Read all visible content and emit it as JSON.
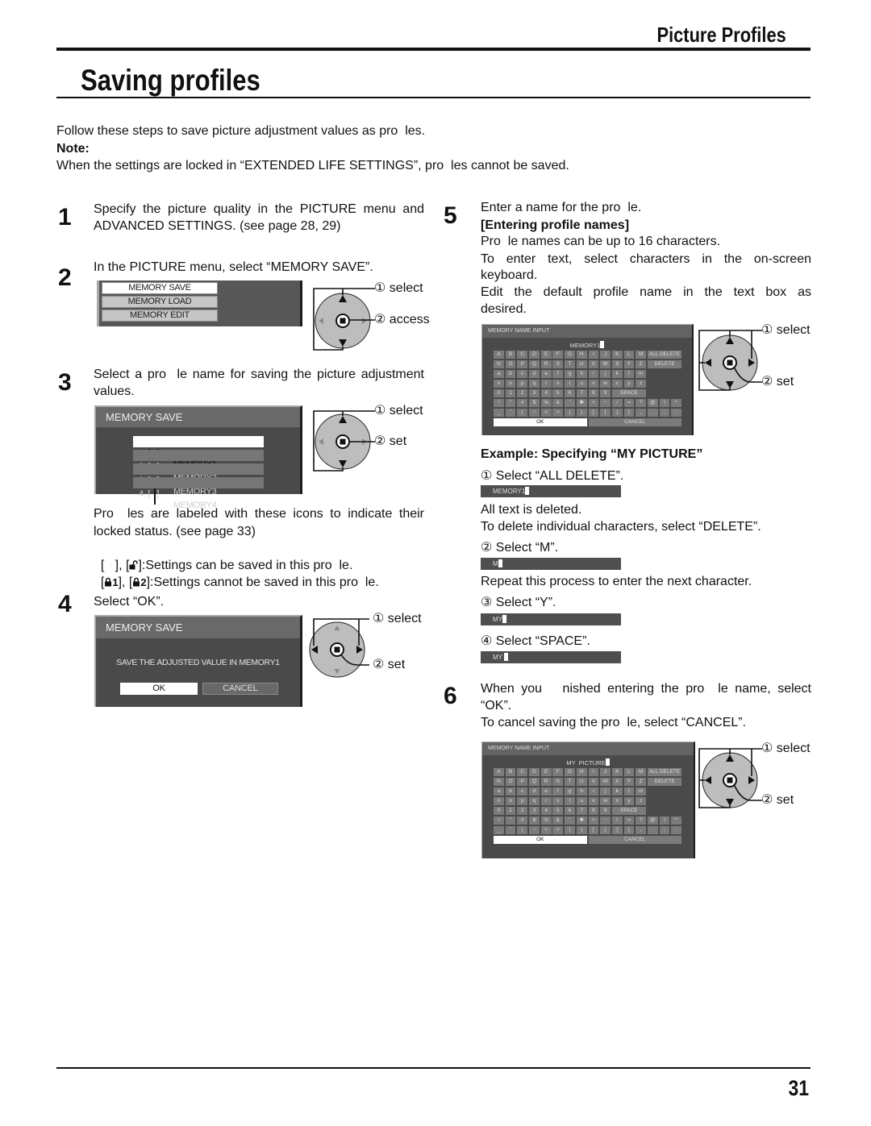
{
  "header": {
    "section_title": "Picture Profiles",
    "page_title": "Saving profiles"
  },
  "intro": {
    "text": "Follow these steps to save picture adjustment values as pro  les.",
    "note_label": "Note:",
    "note_text": "When the settings are locked in “EXTENDED LIFE SETTINGS”, pro  les cannot be saved."
  },
  "step1": {
    "number": "1",
    "lines": [
      "Specify the picture quality in the PICTURE menu and",
      "ADVANCED SETTINGS. (see page 28, 29)"
    ]
  },
  "step2": {
    "number": "2",
    "text": "In the PICTURE menu, select “MEMORY SAVE”.",
    "menu": {
      "items": [
        "MEMORY SAVE",
        "MEMORY LOAD",
        "MEMORY EDIT"
      ],
      "selected": "MEMORY SAVE"
    },
    "remote": {
      "select_label": "① select",
      "action_label": "② access"
    }
  },
  "step3": {
    "number": "3",
    "lines": [
      "Select a pro  le name for saving the picture adjustment",
      "values."
    ],
    "screen": {
      "title": "MEMORY SAVE",
      "items": [
        {
          "index": "1. [   ]",
          "name": "MEMORY1"
        },
        {
          "index": "2. [   ]",
          "name": "MEMORY2"
        },
        {
          "index": "3. [   ]",
          "name": "MEMORY3"
        },
        {
          "index": "4. [   ]",
          "name": "MEMORY4"
        }
      ],
      "selected": "MEMORY1"
    },
    "remote": {
      "select_label": "① select",
      "action_label": "② set"
    },
    "legend": {
      "lines": [
        "Pro  les are labeled with these icons to indicate their",
        "locked status. (see page 33)"
      ],
      "unlocked": {
        "prefix": "[   ], [",
        "suffix": "]:Settings can be saved in this pro  le."
      },
      "locked": {
        "open": "[",
        "num1": "1",
        "sep": "], [",
        "num2": "2",
        "suffix": "]:Settings cannot be saved in this pro  le."
      }
    }
  },
  "step4": {
    "number": "4",
    "text": "Select “OK”.",
    "screen": {
      "title": "MEMORY SAVE",
      "message": "SAVE THE ADJUSTED VALUE IN MEMORY1",
      "ok_label": "OK",
      "cancel_label": "CANCEL",
      "selected": "OK"
    },
    "remote": {
      "select_label": "① select",
      "action_label": "② set"
    }
  },
  "step5": {
    "number": "5",
    "text": "Enter a name for the pro  le.",
    "subheading": "[Entering profile names]",
    "body_lines": [
      "Pro  le names can be up to 16 characters.",
      "To enter text, select characters in the on-screen",
      "keyboard.",
      "Edit the default profile name in the text box as",
      "desired."
    ],
    "keyboard": {
      "title": "MEMORY NAME INPUT",
      "name_value": "MEMORY1",
      "selected_key": "OK"
    },
    "remote": {
      "select_label": "① select",
      "action_label": "② set"
    },
    "example": {
      "heading": "Example: Specifying “MY PICTURE”",
      "substeps": [
        {
          "label": "① Select “ALL DELETE”.",
          "field": "MEMORY1",
          "notes": [
            "All text is deleted.",
            "To delete individual characters, select “DELETE”."
          ]
        },
        {
          "label": "② Select “M”.",
          "field": "M",
          "notes": [
            "Repeat this process to enter the next character."
          ]
        },
        {
          "label": "③ Select “Y”.",
          "field": "MY",
          "notes": []
        },
        {
          "label": "④ Select “SPACE”.",
          "field": "MY ",
          "notes": []
        }
      ]
    }
  },
  "step6": {
    "number": "6",
    "lines": [
      "When you   nished entering the pro  le name, select",
      "“OK”.",
      "To cancel saving the pro  le, select “CANCEL”."
    ],
    "keyboard": {
      "title": "MEMORY NAME INPUT",
      "name_value": "MY  PICTURE",
      "selected_key": "OK"
    },
    "remote": {
      "select_label": "① select",
      "action_label": "② set"
    }
  },
  "keyboard_keys": [
    [
      "A",
      "B",
      "C",
      "D",
      "E",
      "F",
      "G",
      "H",
      "I",
      "J",
      "K",
      "L",
      "M",
      "ALL DELETE"
    ],
    [
      "N",
      "O",
      "P",
      "Q",
      "R",
      "S",
      "T",
      "U",
      "V",
      "W",
      "X",
      "Y",
      "Z",
      "DELETE"
    ],
    [
      "a",
      "b",
      "c",
      "d",
      "e",
      "f",
      "g",
      "h",
      "i",
      "j",
      "k",
      "l",
      "m"
    ],
    [
      "n",
      "o",
      "p",
      "q",
      "r",
      "s",
      "t",
      "u",
      "v",
      "w",
      "x",
      "y",
      "z"
    ],
    [
      "0",
      "1",
      "2",
      "3",
      "4",
      "5",
      "6",
      "7",
      "8",
      "9",
      "SPACE"
    ],
    [
      "!",
      "\"",
      "#",
      "$",
      "%",
      "&",
      "'",
      "✱",
      "+",
      "−",
      "/",
      "=",
      "?",
      "@",
      "\\",
      "^"
    ],
    [
      "_",
      "`",
      "|",
      "~",
      "<",
      ">",
      "(",
      ")",
      "[",
      "]",
      "{",
      "}",
      ",",
      ".",
      ";",
      ":"
    ],
    [
      "OK",
      "CANCEL"
    ]
  ],
  "footer": {
    "page_number": "31"
  },
  "colors": {
    "text": "#111111",
    "osd_body": "#4a4a4a",
    "osd_titlebar": "#696969",
    "osd_item": "#767676",
    "osd_selected": "#ffffff",
    "dpad": "#bdbdbd"
  }
}
